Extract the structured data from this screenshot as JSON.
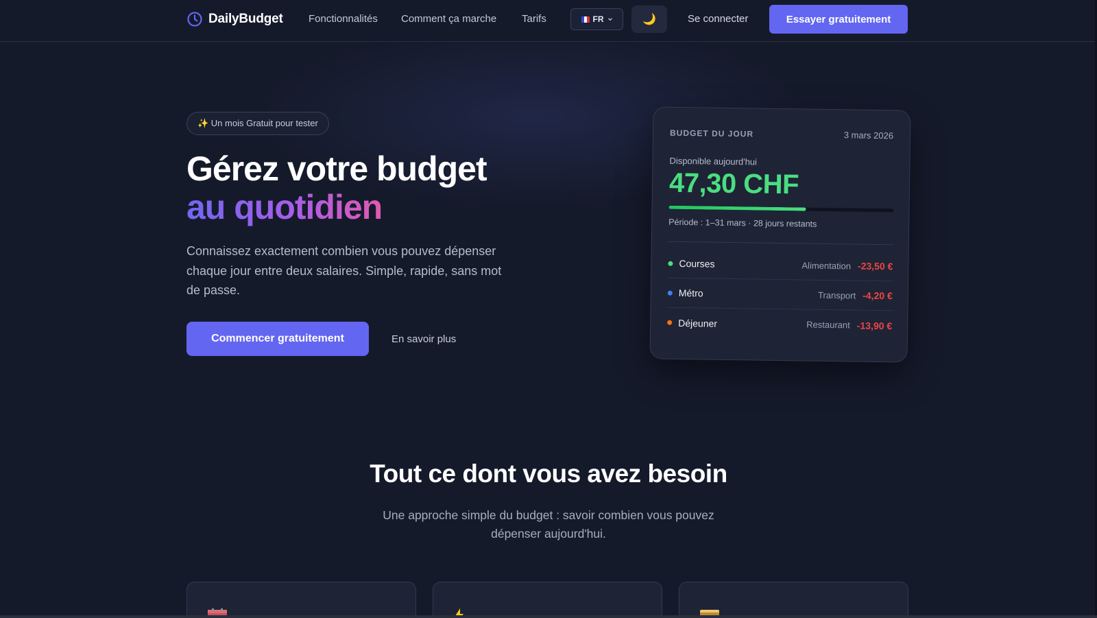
{
  "nav": {
    "brand": "DailyBudget",
    "links": [
      "Fonctionnalités",
      "Comment ça marche",
      "Tarifs"
    ],
    "language": "FR",
    "theme_icon": "moon-icon",
    "login": "Se connecter",
    "cta": "Essayer gratuitement"
  },
  "hero": {
    "badge": "✨ Un mois Gratuit pour tester",
    "title_line1": "Gérez votre budget",
    "title_line2": "au quotidien",
    "lead": "Connaissez exactement combien vous pouvez dépenser chaque jour entre deux salaires. Simple, rapide, sans mot de passe.",
    "primary_button": "Commencer gratuitement",
    "secondary_link": "En savoir plus"
  },
  "budget_card": {
    "title": "BUDGET DU JOUR",
    "date": "3 mars 2026",
    "available_label": "Disponible aujourd'hui",
    "amount": "47,30 CHF",
    "progress_fraction": 0.61,
    "period": "Période : 1–31 mars · 28 jours restants",
    "transactions": [
      {
        "name": "Courses",
        "category": "Alimentation",
        "amount": "-23,50 €",
        "dot_color": "#4ade80"
      },
      {
        "name": "Métro",
        "category": "Transport",
        "amount": "-4,20 €",
        "dot_color": "#3b82f6"
      },
      {
        "name": "Déjeuner",
        "category": "Restaurant",
        "amount": "-13,90 €",
        "dot_color": "#f97316"
      }
    ]
  },
  "features": {
    "title": "Tout ce dont vous avez besoin",
    "subtitle": "Une approche simple du budget : savoir combien vous pouvez dépenser aujourd'hui.",
    "cards": [
      {
        "icon": "calendar-icon"
      },
      {
        "icon": "lightning-icon"
      },
      {
        "icon": "credit-card-icon"
      }
    ]
  },
  "colors": {
    "accent": "#6366f1",
    "positive": "#4ade80",
    "negative": "#ef4444",
    "background": "#151a2b"
  }
}
